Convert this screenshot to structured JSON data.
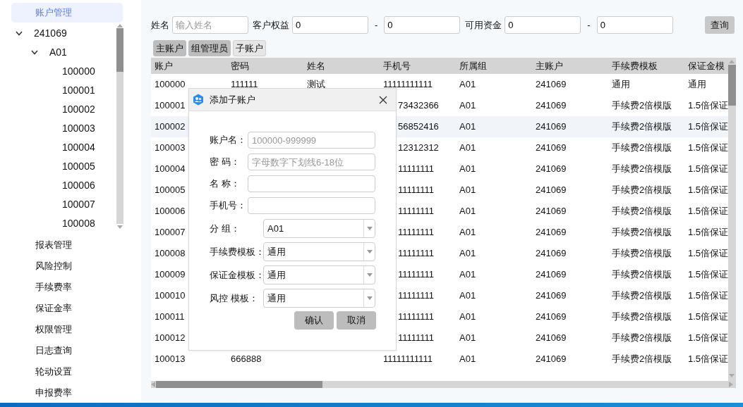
{
  "sidebar": {
    "top_items": [
      {
        "label": "账户管理",
        "selected": true
      }
    ],
    "tree": [
      {
        "label": "241069",
        "expanded": true,
        "children": [
          {
            "label": "A01",
            "expanded": true,
            "children": [
              {
                "label": "100000"
              },
              {
                "label": "100001"
              },
              {
                "label": "100002"
              },
              {
                "label": "100003"
              },
              {
                "label": "100004"
              },
              {
                "label": "100005"
              },
              {
                "label": "100006"
              },
              {
                "label": "100007"
              },
              {
                "label": "100008"
              }
            ]
          }
        ]
      }
    ],
    "items": [
      {
        "label": "报表管理",
        "selected": false
      },
      {
        "label": "风险控制",
        "selected": false
      },
      {
        "label": "手续费率",
        "selected": false
      },
      {
        "label": "保证金率",
        "selected": false
      },
      {
        "label": "权限管理",
        "selected": false
      },
      {
        "label": "日志查询",
        "selected": false
      },
      {
        "label": "轮动设置",
        "selected": false
      },
      {
        "label": "申报费率",
        "selected": false
      }
    ]
  },
  "filters": {
    "name": {
      "label": "姓名",
      "placeholder": "输入姓名"
    },
    "equity": {
      "label": "客户权益",
      "from": "0",
      "separator": "-",
      "to": "0"
    },
    "funds": {
      "label": "可用资金",
      "from": "0",
      "separator": "-",
      "to": "0"
    },
    "query_button": "查询"
  },
  "tabs": [
    {
      "label": "主账户",
      "selected": false
    },
    {
      "label": "组管理员",
      "selected": false
    },
    {
      "label": "子账户",
      "selected": true
    }
  ],
  "table": {
    "columns": [
      "账户",
      "密码",
      "姓名",
      "手机号",
      "所属组",
      "主账户",
      "手续费模板",
      "保证金模"
    ],
    "rows": [
      {
        "selected": false,
        "cells": {
          "account": "100000",
          "password": "111111",
          "name": "测试",
          "phone": "11111111111",
          "group": "A01",
          "main_account": "241069",
          "fee_template": "通用",
          "margin_template": "通用"
        }
      },
      {
        "selected": false,
        "cells": {
          "account": "100001",
          "phone": "73432366",
          "group": "A01",
          "main_account": "241069",
          "fee_template": "手续费2倍模版",
          "margin_template": "1.5倍保证"
        }
      },
      {
        "selected": true,
        "cells": {
          "account": "100002",
          "phone": "56852416",
          "group": "A01",
          "main_account": "241069",
          "fee_template": "手续费2倍模版",
          "margin_template": "1.5倍保证"
        }
      },
      {
        "selected": false,
        "cells": {
          "account": "100003",
          "phone": "12312312",
          "group": "A01",
          "main_account": "241069",
          "fee_template": "手续费2倍模版",
          "margin_template": "1.5倍保证"
        }
      },
      {
        "selected": false,
        "cells": {
          "account": "100004",
          "phone": "11111111",
          "group": "A01",
          "main_account": "241069",
          "fee_template": "手续费2倍模版",
          "margin_template": "1.5倍保证"
        }
      },
      {
        "selected": false,
        "cells": {
          "account": "100005",
          "phone": "11111111",
          "group": "A01",
          "main_account": "241069",
          "fee_template": "手续费2倍模版",
          "margin_template": "1.5倍保证"
        }
      },
      {
        "selected": false,
        "cells": {
          "account": "100006",
          "phone": "11111111",
          "group": "A01",
          "main_account": "241069",
          "fee_template": "手续费2倍模版",
          "margin_template": "1.5倍保证"
        }
      },
      {
        "selected": false,
        "cells": {
          "account": "100007",
          "phone": "11111111",
          "group": "A01",
          "main_account": "241069",
          "fee_template": "手续费2倍模版",
          "margin_template": "1.5倍保证"
        }
      },
      {
        "selected": false,
        "cells": {
          "account": "100008",
          "phone": "11111111",
          "group": "A01",
          "main_account": "241069",
          "fee_template": "手续费2倍模版",
          "margin_template": "1.5倍保证"
        }
      },
      {
        "selected": false,
        "cells": {
          "account": "100009",
          "phone": "11111111",
          "group": "A01",
          "main_account": "241069",
          "fee_template": "手续费2倍模版",
          "margin_template": "1.5倍保证"
        }
      },
      {
        "selected": false,
        "cells": {
          "account": "100010",
          "phone": "11111111",
          "group": "A01",
          "main_account": "241069",
          "fee_template": "手续费2倍模版",
          "margin_template": "1.5倍保证"
        }
      },
      {
        "selected": false,
        "cells": {
          "account": "100011",
          "phone": "11111111",
          "group": "A01",
          "main_account": "241069",
          "fee_template": "手续费2倍模版",
          "margin_template": "1.5倍保证"
        }
      },
      {
        "selected": false,
        "cells": {
          "account": "100012",
          "phone": "11111111",
          "group": "A01",
          "main_account": "241069",
          "fee_template": "手续费2倍模版",
          "margin_template": "1.5倍保证"
        }
      },
      {
        "selected": false,
        "cells": {
          "account": "100013",
          "password": "666888",
          "phone": "11111111111",
          "group": "A01",
          "main_account": "241069",
          "fee_template": "手续费2倍模版",
          "margin_template": "1.5倍保证"
        }
      }
    ]
  },
  "dialog": {
    "title": "添加子账户",
    "fields": [
      {
        "label": "账户名：",
        "kind": "text",
        "placeholder": "100000-999999"
      },
      {
        "label": "密 码：",
        "kind": "text",
        "placeholder": "字母数字下划线6-18位"
      },
      {
        "label": "名 称：",
        "kind": "text"
      },
      {
        "label": "手机号：",
        "kind": "text"
      },
      {
        "label": "分 组：",
        "kind": "select",
        "value": "A01"
      },
      {
        "label": "手续费模板：",
        "kind": "select",
        "value": "通用"
      },
      {
        "label": "保证金模板：",
        "kind": "select",
        "value": "通用"
      },
      {
        "label": "风控 模板：",
        "kind": "select",
        "value": "通用"
      }
    ],
    "buttons": [
      "确认",
      "取消"
    ]
  }
}
